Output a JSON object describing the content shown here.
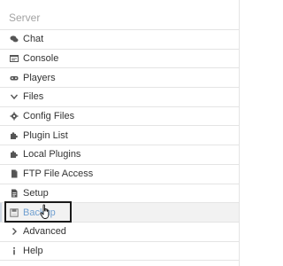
{
  "sidebar": {
    "title": "Server",
    "items": [
      {
        "label": "Chat",
        "icon": "chat-bubbles-icon"
      },
      {
        "label": "Console",
        "icon": "terminal-icon"
      },
      {
        "label": "Players",
        "icon": "gamepad-icon"
      },
      {
        "label": "Files",
        "icon": "chevron-down-icon"
      },
      {
        "label": "Config Files",
        "icon": "gear-icon"
      },
      {
        "label": "Plugin List",
        "icon": "puzzle-icon"
      },
      {
        "label": "Local Plugins",
        "icon": "puzzle-icon"
      },
      {
        "label": "FTP File Access",
        "icon": "file-icon"
      },
      {
        "label": "Setup",
        "icon": "file-text-icon"
      },
      {
        "label": "Backup",
        "icon": "save-icon"
      },
      {
        "label": "Advanced",
        "icon": "chevron-right-icon"
      },
      {
        "label": "Help",
        "icon": "info-icon"
      }
    ]
  },
  "colors": {
    "text": "#333333",
    "muted": "#a3a3a3",
    "link": "#6f9fd0",
    "divider": "#e4e4e4",
    "highlight": "#1a1a1a"
  }
}
